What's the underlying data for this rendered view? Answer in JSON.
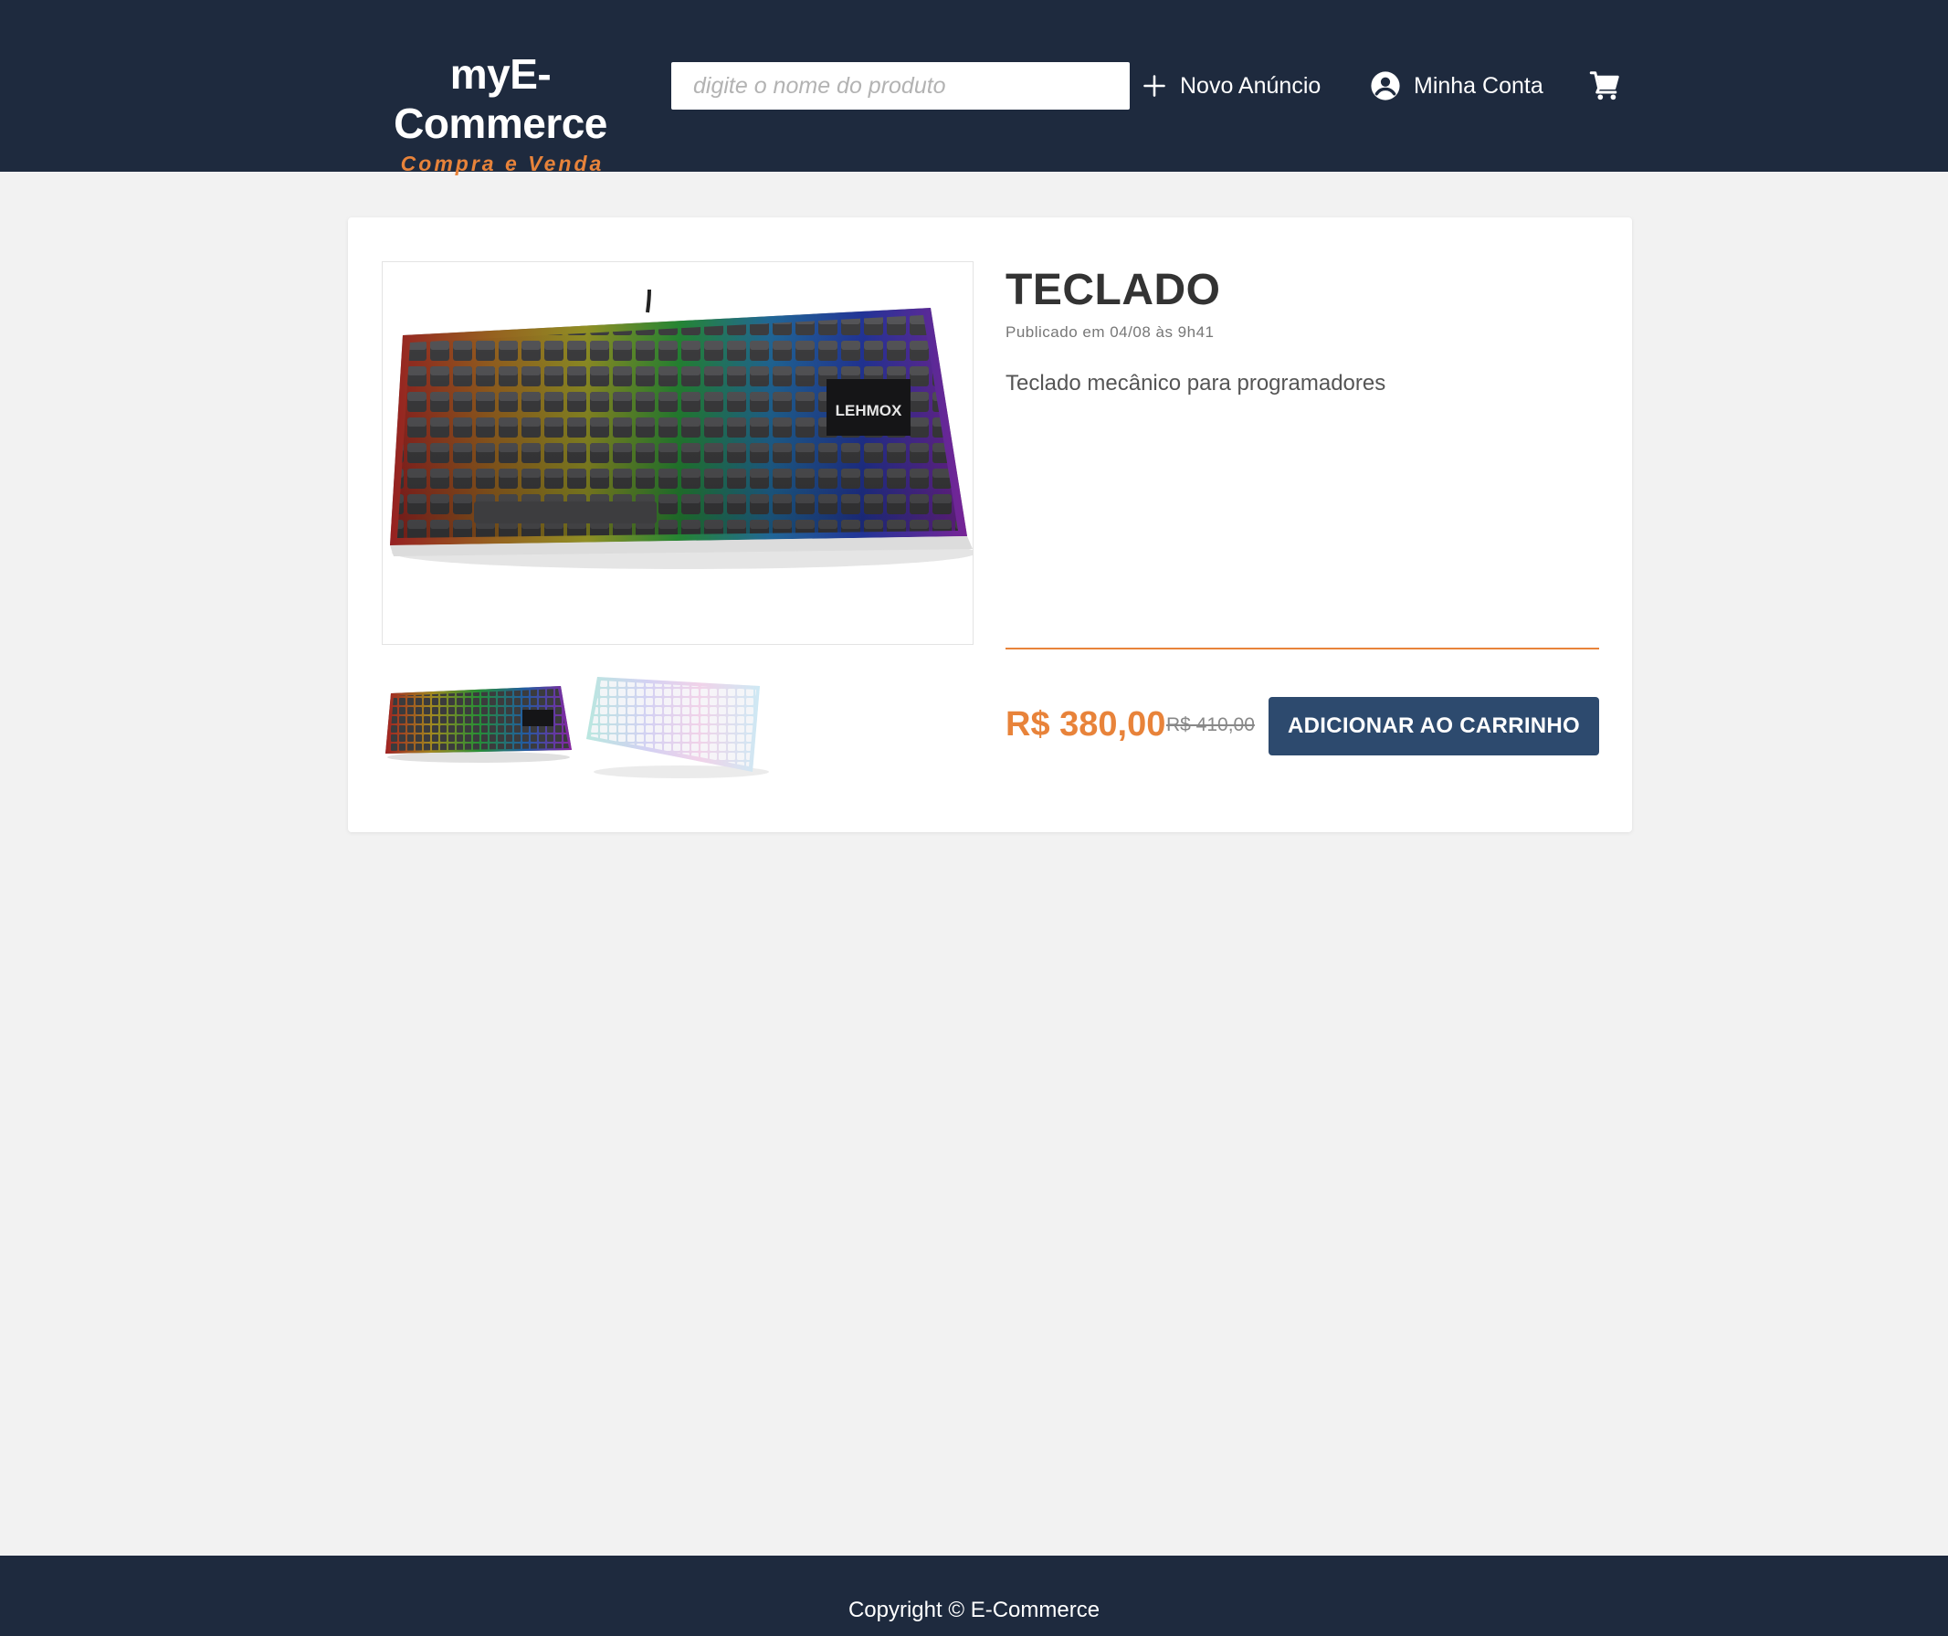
{
  "header": {
    "logo_title": "myE-Commerce",
    "logo_subtitle": "Compra e Venda",
    "search_placeholder": "digite o nome do produto",
    "nav": {
      "new_listing": "Novo Anúncio",
      "my_account": "Minha Conta"
    },
    "icons": {
      "new_listing": "plus-icon",
      "my_account": "account-circle-icon",
      "cart": "shopping-cart-icon"
    }
  },
  "product": {
    "title": "TECLADO",
    "published": "Publicado em 04/08 às 9h41",
    "description": "Teclado mecânico para programadores",
    "price": "R$ 380,00",
    "old_price": "R$ 410,00",
    "add_to_cart_label": "ADICIONAR AO CARRINHO",
    "image_brand": "LEHMOX",
    "thumbnails": [
      "black-rgb-keyboard",
      "white-rgb-keyboard"
    ]
  },
  "footer": {
    "copyright": "Copyright © E-Commerce"
  },
  "colors": {
    "header_bg": "#1e2a3e",
    "accent": "#e8833a",
    "button_bg": "#2d4a6e",
    "page_bg": "#f2f2f2"
  }
}
